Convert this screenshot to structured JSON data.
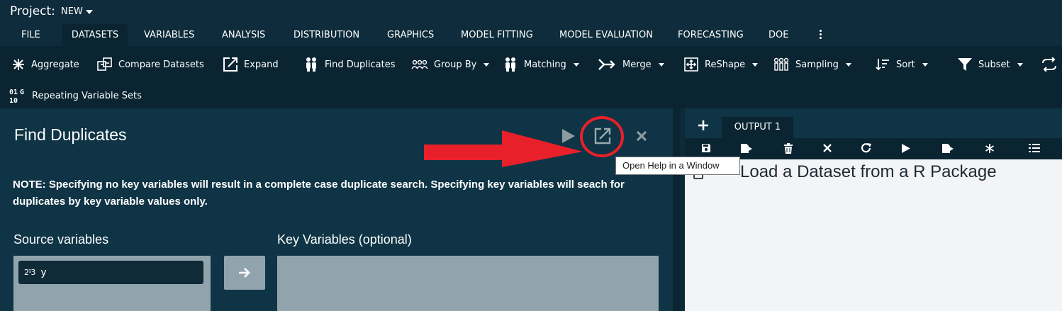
{
  "project": {
    "label": "Project:",
    "name": "NEW"
  },
  "tabs": [
    {
      "label": "FILE"
    },
    {
      "label": "DATASETS"
    },
    {
      "label": "VARIABLES"
    },
    {
      "label": "ANALYSIS"
    },
    {
      "label": "DISTRIBUTION"
    },
    {
      "label": "GRAPHICS"
    },
    {
      "label": "MODEL FITTING"
    },
    {
      "label": "MODEL EVALUATION"
    },
    {
      "label": "FORECASTING"
    },
    {
      "label": "DOE"
    }
  ],
  "toolbar": {
    "aggregate": "Aggregate",
    "compare": "Compare Datasets",
    "expand": "Expand",
    "find_duplicates": "Find Duplicates",
    "group_by": "Group By",
    "matching": "Matching",
    "merge": "Merge",
    "reshape": "ReShape",
    "sampling": "Sampling",
    "sort": "Sort",
    "subset": "Subset",
    "repeating": "Repeating Variable Sets"
  },
  "dialog": {
    "title": "Find Duplicates",
    "note": "NOTE: Specifying no key variables will result in a complete case duplicate search. Specifying key variables will seach for duplicates by key variable values only.",
    "source_label": "Source variables",
    "key_label": "Key Variables (optional)",
    "source_items": [
      {
        "icon": "2¹3",
        "name": "y"
      }
    ]
  },
  "tooltip": "Open Help in a Window",
  "output": {
    "tab_label": "OUTPUT 1",
    "heading": "Load a Dataset from a R Package"
  },
  "colors": {
    "background": "#0b2a38",
    "panel": "#0f3445",
    "annotation_red": "#e8202a",
    "list_box": "#91a4ad"
  }
}
